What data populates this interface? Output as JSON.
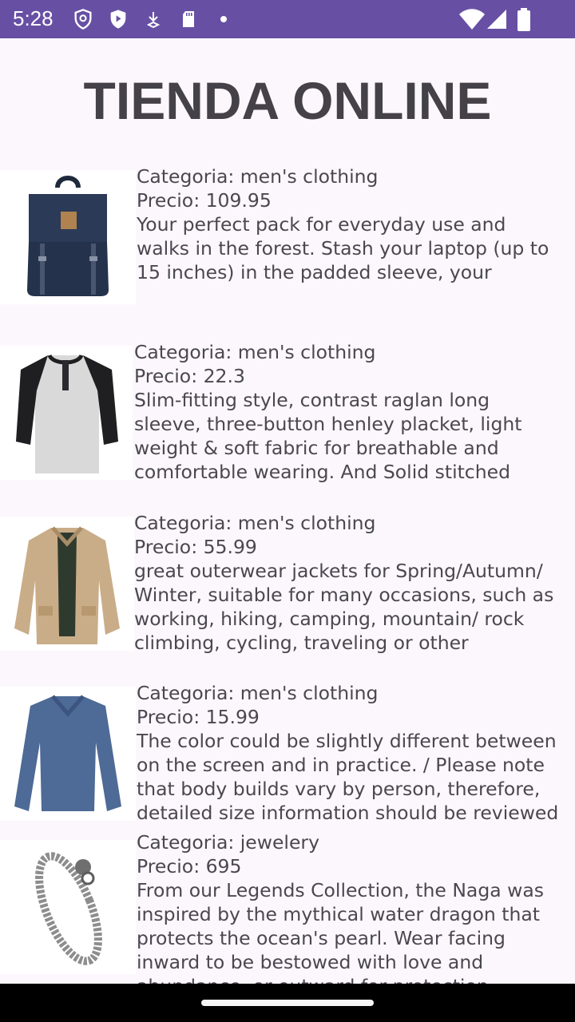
{
  "status_bar": {
    "time": "5:28",
    "icons": [
      "shield-icon",
      "play-protect-icon",
      "download-icon",
      "sd-card-icon",
      "dot-icon",
      "wifi-icon",
      "signal-icon",
      "battery-icon"
    ]
  },
  "page_title": "TIENDA ONLINE",
  "products": [
    {
      "category_line": "Categoria: men's clothing",
      "price_line": "Precio: 109.95",
      "description": "Your perfect pack for everyday use and walks in the forest. Stash your laptop (up to 15 inches) in the padded sleeve, your everyday",
      "image_icon": "backpack-image"
    },
    {
      "category_line": "Categoria: men's clothing",
      "price_line": "Precio: 22.3",
      "description": "Slim-fitting style, contrast raglan long sleeve, three-button henley placket, light weight & soft fabric for breathable and comfortable wearing. And Solid stitched shirts with round neck made for durability and a great fit for casual fashion",
      "image_icon": "henley-shirt-image"
    },
    {
      "category_line": "Categoria: men's clothing",
      "price_line": "Precio: 55.99",
      "description": "great outerwear jackets for Spring/Autumn/ Winter, suitable for many occasions, such as working, hiking, camping, mountain/ rock climbing, cycling, traveling or other outdoors. Good gift choice for you",
      "image_icon": "jacket-image"
    },
    {
      "category_line": "Categoria: men's clothing",
      "price_line": "Precio: 15.99",
      "description": "The color could be slightly different between on the screen and in practice. / Please note that body builds vary by person, therefore, detailed size information should be reviewed",
      "image_icon": "long-sleeve-shirt-image"
    },
    {
      "category_line": "Categoria: jewelery",
      "price_line": "Precio: 695",
      "description": "From our Legends Collection, the Naga was inspired by the mythical water dragon that protects the ocean's pearl. Wear facing inward to be bestowed with love and abundance, or outward for protection.",
      "image_icon": "bracelet-image"
    }
  ]
}
